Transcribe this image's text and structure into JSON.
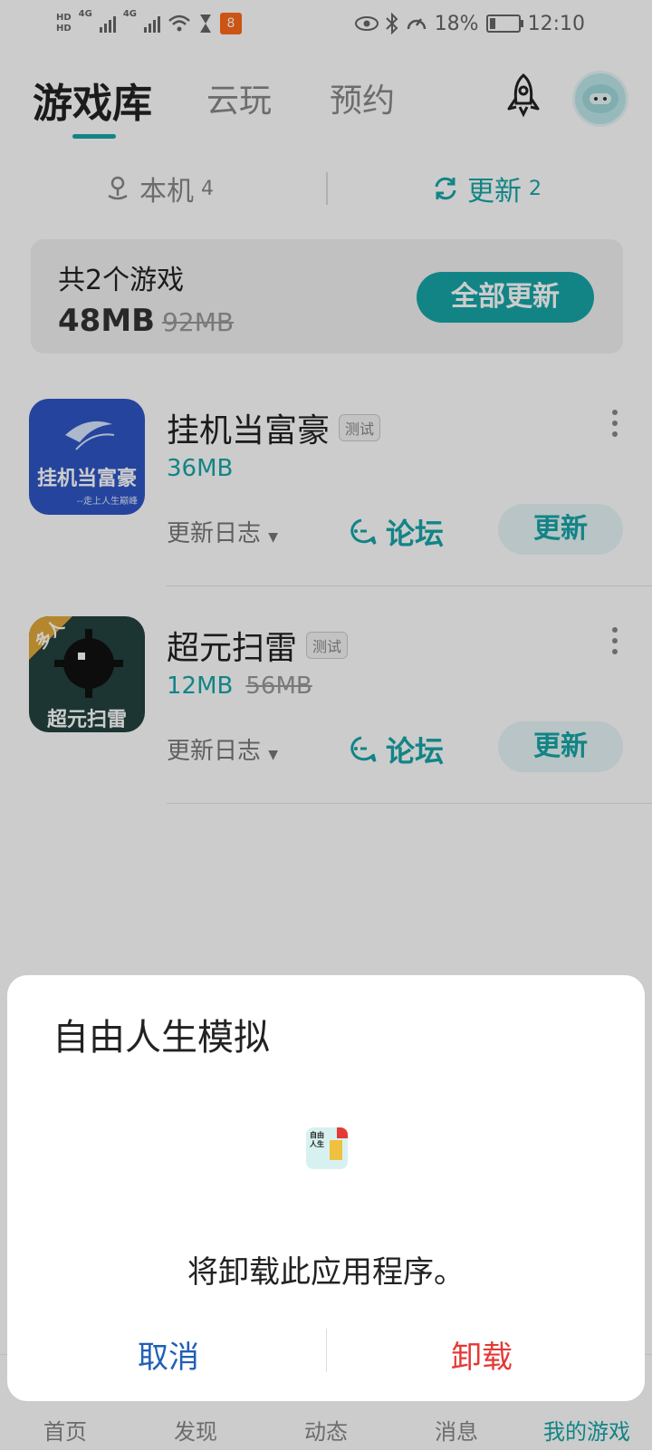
{
  "status_bar": {
    "hd_top": "HD",
    "hd_bottom": "HD",
    "net1": "4G",
    "net2": "4G",
    "battery_percent": "18%",
    "time": "12:10",
    "battery_level": 0.18
  },
  "header": {
    "tabs": [
      {
        "label": "游戏库",
        "active": true
      },
      {
        "label": "云玩",
        "active": false
      },
      {
        "label": "预约",
        "active": false
      }
    ]
  },
  "subtabs": {
    "local": {
      "label": "本机",
      "count": "4"
    },
    "update": {
      "label": "更新",
      "count": "2"
    }
  },
  "summary": {
    "count_text": "共2个游戏",
    "size": "48MB",
    "original_size": "92MB",
    "update_all_label": "全部更新"
  },
  "games": [
    {
      "name": "挂机当富豪",
      "tag": "测试",
      "size": "36MB",
      "original_size": "",
      "changelog_label": "更新日志",
      "forum_label": "论坛",
      "update_label": "更新",
      "icon_text": "挂机当富豪",
      "icon_subtext": "--走上人生巅峰"
    },
    {
      "name": "超元扫雷",
      "tag": "测试",
      "size": "12MB",
      "original_size": "56MB",
      "changelog_label": "更新日志",
      "forum_label": "论坛",
      "update_label": "更新",
      "icon_text": "超元扫雷",
      "icon_badge": "多人"
    }
  ],
  "bottom_nav": {
    "items": [
      {
        "label": "首页"
      },
      {
        "label": "发现"
      },
      {
        "label": "动态"
      },
      {
        "label": "消息"
      },
      {
        "label": "我的游戏",
        "active": true
      }
    ]
  },
  "dialog": {
    "title": "自由人生模拟",
    "message": "将卸载此应用程序。",
    "cancel_label": "取消",
    "confirm_label": "卸载",
    "icon_text": "自由人生"
  },
  "colors": {
    "accent": "#17a6a8",
    "danger": "#e53935",
    "cancel_blue": "#1f5fb8"
  }
}
